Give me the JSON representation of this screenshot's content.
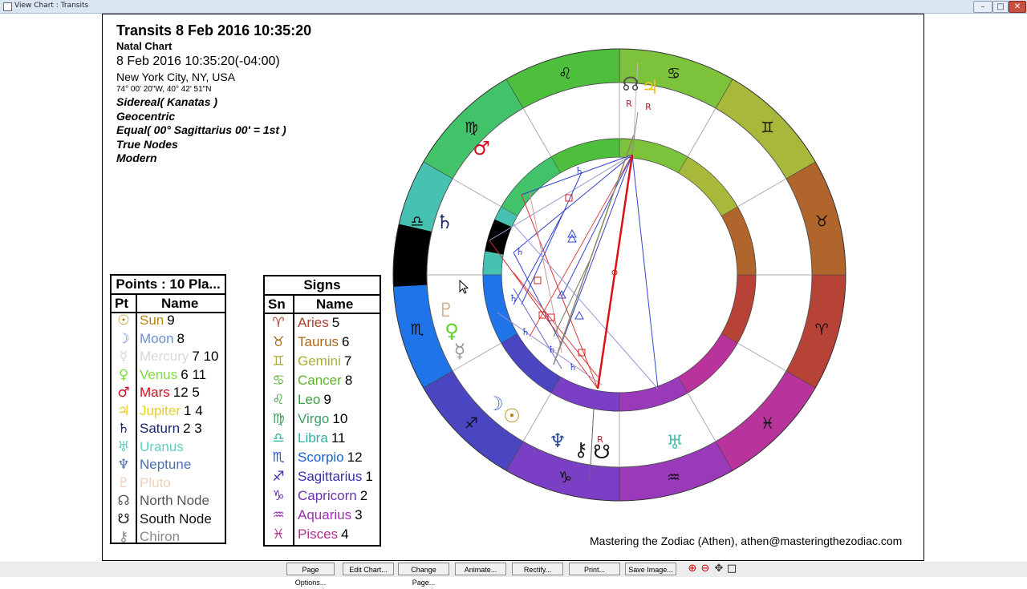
{
  "window": {
    "title": "View Chart : Transits",
    "controls": [
      "–",
      "□",
      "✕"
    ]
  },
  "header": {
    "title": "Transits 8 Feb 2016 10:35:20",
    "subtitle": "Natal Chart",
    "datetime": "8 Feb 2016 10:35:20(-04:00)",
    "location": "New York City, NY, USA",
    "coords": "74° 00' 20\"W, 40° 42' 51\"N",
    "zodiac": "Sidereal( Kanatas )",
    "centric": "Geocentric",
    "houses": "Equal( 00° Sagittarius 00' = 1st )",
    "nodes": "True Nodes",
    "style": "Modern"
  },
  "points_table": {
    "caption": "Points : 10 Pla...",
    "col_pt": "Pt",
    "col_name": "Name",
    "rows": [
      {
        "glyph": "☉",
        "name": "Sun",
        "nums": "9",
        "color": "#b8860b"
      },
      {
        "glyph": "☽",
        "name": "Moon",
        "nums": "8",
        "color": "#6b8fd4"
      },
      {
        "glyph": "☿",
        "name": "Mercury",
        "nums": "7 10",
        "color": "#d8d8d8"
      },
      {
        "glyph": "♀",
        "name": "Venus",
        "nums": "6 11",
        "color": "#7fdd3a"
      },
      {
        "glyph": "♂",
        "name": "Mars",
        "nums": "12 5",
        "color": "#cc1122"
      },
      {
        "glyph": "♃",
        "name": "Jupiter",
        "nums": "1 4",
        "color": "#e8d020"
      },
      {
        "glyph": "♄",
        "name": "Saturn",
        "nums": "2 3",
        "color": "#1a2a6c"
      },
      {
        "glyph": "♅",
        "name": "Uranus",
        "nums": "",
        "color": "#5fd0c0"
      },
      {
        "glyph": "♆",
        "name": "Neptune",
        "nums": "",
        "color": "#4a6fb5"
      },
      {
        "glyph": "♇",
        "name": "Pluto",
        "nums": "",
        "color": "#f0d0b8"
      },
      {
        "glyph": "☊",
        "name": "North Node",
        "nums": "",
        "color": "#555555"
      },
      {
        "glyph": "☋",
        "name": "South Node",
        "nums": "",
        "color": "#111111"
      },
      {
        "glyph": "⚷",
        "name": "Chiron",
        "nums": "",
        "color": "#888888"
      }
    ]
  },
  "signs_table": {
    "caption": "Signs",
    "col_sn": "Sn",
    "col_name": "Name",
    "rows": [
      {
        "glyph": "♈",
        "name": "Aries",
        "nums": "5",
        "color": "#b04030"
      },
      {
        "glyph": "♉",
        "name": "Taurus",
        "nums": "6",
        "color": "#a86a1a"
      },
      {
        "glyph": "♊",
        "name": "Gemini",
        "nums": "7",
        "color": "#a8b030"
      },
      {
        "glyph": "♋",
        "name": "Cancer",
        "nums": "8",
        "color": "#5db030"
      },
      {
        "glyph": "♌",
        "name": "Leo",
        "nums": "9",
        "color": "#3aa040"
      },
      {
        "glyph": "♍",
        "name": "Virgo",
        "nums": "10",
        "color": "#3aa060"
      },
      {
        "glyph": "♎",
        "name": "Libra",
        "nums": "11",
        "color": "#30b0a0"
      },
      {
        "glyph": "♏",
        "name": "Scorpio",
        "nums": "12",
        "color": "#1a5fd0"
      },
      {
        "glyph": "♐",
        "name": "Sagittarius",
        "nums": "1",
        "color": "#3a30b0"
      },
      {
        "glyph": "♑",
        "name": "Capricorn",
        "nums": "2",
        "color": "#6a30b0"
      },
      {
        "glyph": "♒",
        "name": "Aquarius",
        "nums": "3",
        "color": "#9a30b0"
      },
      {
        "glyph": "♓",
        "name": "Pisces",
        "nums": "4",
        "color": "#b03090"
      }
    ]
  },
  "wheel": {
    "signs": [
      {
        "glyph": "♈",
        "color": "#b74236"
      },
      {
        "glyph": "♉",
        "color": "#b0652d"
      },
      {
        "glyph": "♊",
        "color": "#a7b83a"
      },
      {
        "glyph": "♋",
        "color": "#7cc23a"
      },
      {
        "glyph": "♌",
        "color": "#4dbf3c"
      },
      {
        "glyph": "♍",
        "color": "#42c36a"
      },
      {
        "glyph": "♎",
        "color": "#47c1b1"
      },
      {
        "glyph": "♏",
        "color": "#1e74e8"
      },
      {
        "glyph": "♐",
        "color": "#4a46c2"
      },
      {
        "glyph": "♑",
        "color": "#7a3fc4"
      },
      {
        "glyph": "♒",
        "color": "#9a3abb"
      },
      {
        "glyph": "♓",
        "color": "#b8339b"
      }
    ],
    "outer_planets": [
      {
        "glyph": "☊",
        "color": "#555555",
        "retro": true
      },
      {
        "glyph": "♃",
        "color": "#e8c420",
        "retro": true
      },
      {
        "glyph": "♂",
        "color": "#cc1122",
        "retro": false
      },
      {
        "glyph": "♄",
        "color": "#1a2a6c",
        "retro": false
      },
      {
        "glyph": "♇",
        "color": "#d8b090",
        "retro": false
      },
      {
        "glyph": "♀",
        "color": "#5fcf2a",
        "retro": false
      },
      {
        "glyph": "☿",
        "color": "#999999",
        "retro": false
      },
      {
        "glyph": "☽",
        "color": "#4a6fd4",
        "retro": false
      },
      {
        "glyph": "☉",
        "color": "#b8860b",
        "retro": false
      },
      {
        "glyph": "♆",
        "color": "#2a4f95",
        "retro": false
      },
      {
        "glyph": "⚷",
        "color": "#222222",
        "retro": false
      },
      {
        "glyph": "☋",
        "color": "#111111",
        "retro": true
      },
      {
        "glyph": "♅",
        "color": "#4ac0b0",
        "retro": false
      }
    ],
    "retro_mark": "R"
  },
  "credit": "Mastering the Zodiac (Athen), athen@masteringthezodiac.com",
  "buttons": [
    "Page Options...",
    "Edit Chart...",
    "Change Page...",
    "Animate...",
    "Rectify...",
    "Print...",
    "Save Image..."
  ],
  "zoom_icons": [
    "zoom-in-icon",
    "zoom-out-icon",
    "pan-icon",
    "fit-icon"
  ]
}
